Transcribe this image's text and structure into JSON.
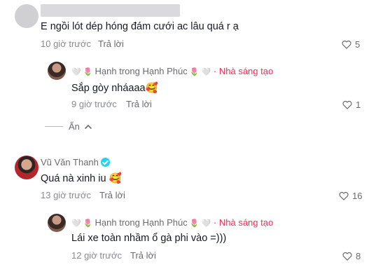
{
  "comments": [
    {
      "text": "E ngồi lót dép hóng đám cưới ac lâu quá r ạ",
      "time": "10 giờ trước",
      "reply_label": "Trả lời",
      "likes": "5"
    },
    {
      "name_prefix": "🤍 🌷 ",
      "name": "Hạnh trong Hạnh Phúc",
      "name_suffix": " 🌷 🤍",
      "badge": "· Nhà sáng tạo",
      "text": "Sắp gòy nháaaa🥰",
      "time": "9 giờ trước",
      "reply_label": "Trả lời",
      "likes": "1"
    },
    {
      "name": "Vũ Văn Thanh",
      "text": "Quá nà xinh iu 🥰",
      "time": "13 giờ trước",
      "reply_label": "Trả lời",
      "likes": "16"
    },
    {
      "name_prefix": "🤍 🌷 ",
      "name": "Hạnh trong Hạnh Phúc",
      "name_suffix": " 🌷 🤍",
      "badge": "· Nhà sáng tạo",
      "text": "Lái xe toàn nhầm ổ gà phi vào =)))",
      "time": "12 giờ trước",
      "reply_label": "Trả lời",
      "likes": "8"
    }
  ],
  "hide_label": "Ẩn",
  "colors": {
    "creator": "#fe2c55",
    "verified": "#20d5ec"
  }
}
